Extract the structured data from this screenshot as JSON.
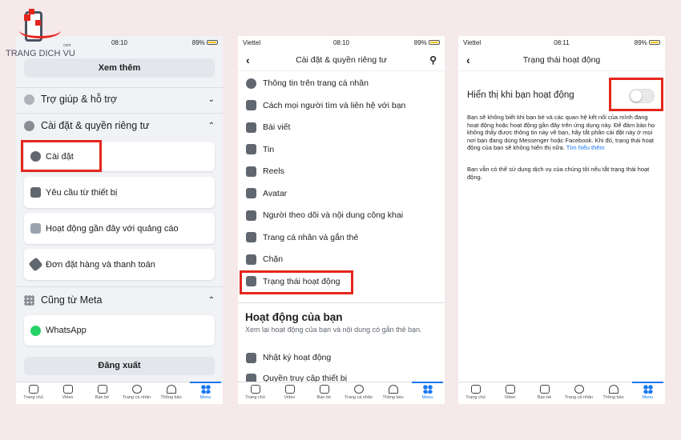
{
  "logo": {
    "text": "TRANG DICH VU",
    "suffix": "com"
  },
  "phone1": {
    "status": {
      "carrier": "",
      "time": "08:10",
      "battery": "89%"
    },
    "see_more": "Xem thêm",
    "help": "Trợ giúp & hỗ trợ",
    "settings_section": "Cài đặt & quyền riêng tư",
    "cards": [
      "Cài đặt",
      "Yêu cầu từ thiết bị",
      "Hoạt động gần đây với quảng cáo",
      "Đơn đặt hàng và thanh toán"
    ],
    "meta_section": "Cũng từ Meta",
    "whatsapp": "WhatsApp",
    "logout": "Đăng xuất"
  },
  "tabs": [
    "Trang chủ",
    "Video",
    "Bạn bè",
    "Trang cá nhân",
    "Thông báo",
    "Menu"
  ],
  "phone2": {
    "status": {
      "carrier": "Viettel",
      "time": "08:10",
      "battery": "89%"
    },
    "title": "Cài đặt & quyền riêng tư",
    "items": [
      "Thông tin trên trang cá nhân",
      "Cách mọi người tìm và liên hệ với bạn",
      "Bài viết",
      "Tin",
      "Reels",
      "Avatar",
      "Người theo dõi và nội dung công khai",
      "Trang cá nhân và gắn thẻ",
      "Chặn",
      "Trạng thái hoạt động"
    ],
    "activity_heading": "Hoạt động của bạn",
    "activity_desc": "Xem lại hoạt động của bạn và nội dung có gắn thẻ bạn.",
    "activity_items": [
      "Nhật ký hoạt động",
      "Quyền truy cập thiết bị"
    ]
  },
  "phone3": {
    "status": {
      "carrier": "Viettel",
      "time": "08:11",
      "battery": "89%"
    },
    "title": "Trạng thái hoạt động",
    "toggle_label": "Hiển thị khi bạn hoạt động",
    "toggle_on": false,
    "desc": "Bạn sẽ không biết khi bạn bè và các quan hệ kết nối của mình đang hoạt động hoặc hoạt động gần đây trên ứng dụng này. Để đảm bảo họ không thấy được thông tin này về bạn, hãy tắt phần cài đặt này ở mọi nơi bạn đang dùng Messenger hoặc Facebook. Khi đó, trạng thái hoạt động của bạn sẽ không hiển thị nữa.",
    "learn_more": "Tìm hiểu thêm",
    "note": "Bạn vẫn có thể sử dụng dịch vụ của chúng tôi nếu tắt trạng thái hoạt động."
  },
  "colors": {
    "accent": "#1877f2",
    "highlight": "#e5261c",
    "background": "#f6e9ea"
  }
}
